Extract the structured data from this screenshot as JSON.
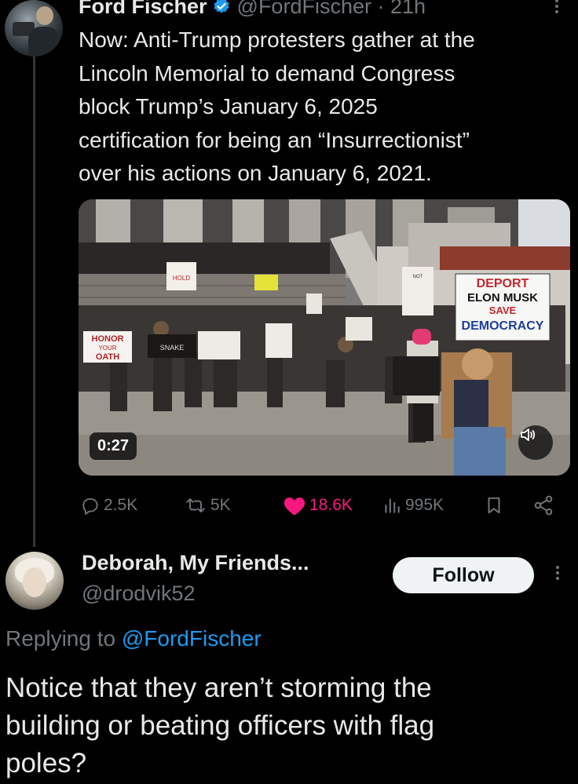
{
  "original_post": {
    "author_name": "Ford Fischer",
    "author_handle": "@FordFischer",
    "separator": "·",
    "time_ago": "21h",
    "text": "Now: Anti-Trump protesters gather at the\nLincoln Memorial to demand Congress\nblock Trump’s January 6, 2025\ncertification for being an “Insurrectionist”\nover his actions on January 6, 2021.",
    "video": {
      "duration": "0:27",
      "signs": {
        "deport_line1": "DEPORT",
        "deport_line2": "ELON MUSK",
        "deport_line3": "SAVE",
        "deport_line4": "DEMOCRACY",
        "honor_line1": "HONOR",
        "honor_line2": "YOUR",
        "honor_line3": "OATH",
        "snake": "SNAKE",
        "hold": "HOLD",
        "not": "NOT"
      }
    },
    "stats": {
      "replies": "2.5K",
      "reposts": "5K",
      "likes": "18.6K",
      "views": "995K"
    }
  },
  "reply": {
    "author_name": "Deborah, My Friends...",
    "author_handle": "@drodvik52",
    "follow_label": "Follow",
    "replying_prefix": "Replying to",
    "replying_to": "@FordFischer",
    "text": "Notice that they aren’t storming the\nbuilding or beating officers with flag\npoles?"
  },
  "colors": {
    "background": "#000000",
    "text_primary": "#e7e9ea",
    "text_secondary": "#71767b",
    "accent_blue": "#1d9bf0",
    "like_pink": "#f91880"
  }
}
